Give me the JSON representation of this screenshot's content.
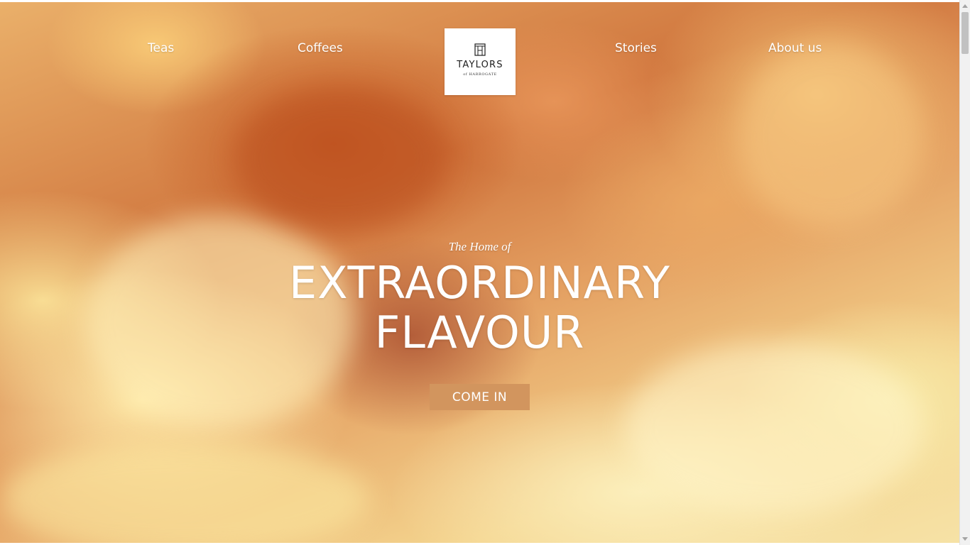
{
  "nav": {
    "items": [
      {
        "label": "Teas"
      },
      {
        "label": "Coffees"
      },
      {
        "label": "Stories"
      },
      {
        "label": "About us"
      }
    ]
  },
  "logo": {
    "wordmark": "TAYLORS",
    "subline": "of HARROGATE"
  },
  "hero": {
    "kicker": "The Home of",
    "title_line1": "EXTRAORDINARY",
    "title_line2": "FLAVOUR",
    "cta_label": "COME IN"
  },
  "colors": {
    "cta_background": "#d2955e",
    "text": "#ffffff",
    "logo_background": "#ffffff"
  }
}
